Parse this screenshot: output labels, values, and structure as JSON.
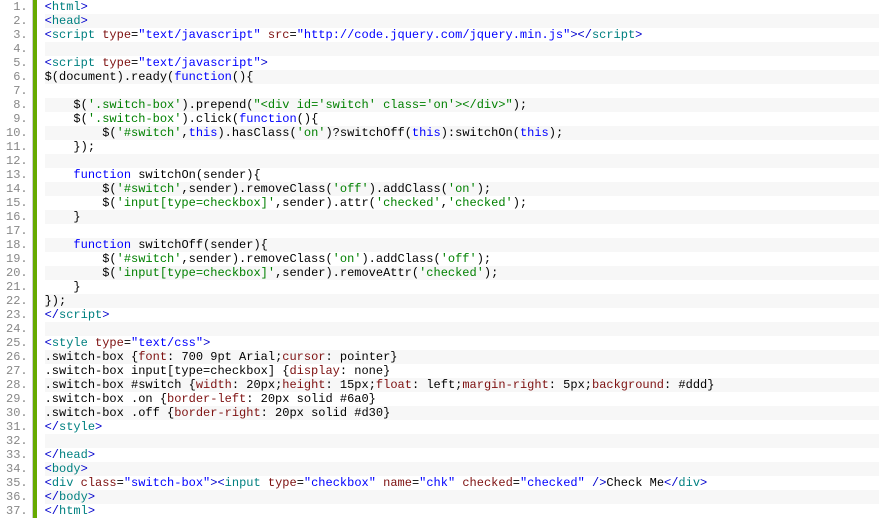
{
  "code": {
    "lines": [
      {
        "n": 1,
        "html": "<span class='t-blue'>&lt;</span><span class='t-tag'>html</span><span class='t-blue'>&gt;</span>"
      },
      {
        "n": 2,
        "html": "<span class='t-blue'>&lt;</span><span class='t-tag'>head</span><span class='t-blue'>&gt;</span>"
      },
      {
        "n": 3,
        "html": "<span class='t-blue'>&lt;</span><span class='t-tag'>script</span> <span class='t-attr'>type</span>=<span class='t-val'>\"text/javascript\"</span> <span class='t-attr'>src</span>=<span class='t-val'>\"http://code.jquery.com/jquery.min.js\"</span><span class='t-blue'>&gt;&lt;/</span><span class='t-tag'>script</span><span class='t-blue'>&gt;</span>"
      },
      {
        "n": 4,
        "html": ""
      },
      {
        "n": 5,
        "html": "<span class='t-blue'>&lt;</span><span class='t-tag'>script</span> <span class='t-attr'>type</span>=<span class='t-val'>\"text/javascript\"</span><span class='t-blue'>&gt;</span>"
      },
      {
        "n": 6,
        "html": "$(document).ready(<span class='t-key'>function</span>(){"
      },
      {
        "n": 7,
        "html": ""
      },
      {
        "n": 8,
        "html": "    $(<span class='t-str'>'.switch-box'</span>).prepend(<span class='t-str'>\"&lt;div id='switch' class='on'&gt;&lt;/div&gt;\"</span>);"
      },
      {
        "n": 9,
        "html": "    $(<span class='t-str'>'.switch-box'</span>).click(<span class='t-key'>function</span>(){"
      },
      {
        "n": 10,
        "html": "        $(<span class='t-str'>'#switch'</span>,<span class='t-key'>this</span>).hasClass(<span class='t-str'>'on'</span>)?switchOff(<span class='t-key'>this</span>):switchOn(<span class='t-key'>this</span>);"
      },
      {
        "n": 11,
        "html": "    });"
      },
      {
        "n": 12,
        "html": ""
      },
      {
        "n": 13,
        "html": "    <span class='t-key'>function</span> switchOn(sender){"
      },
      {
        "n": 14,
        "html": "        $(<span class='t-str'>'#switch'</span>,sender).removeClass(<span class='t-str'>'off'</span>).addClass(<span class='t-str'>'on'</span>);"
      },
      {
        "n": 15,
        "html": "        $(<span class='t-str'>'input[type=checkbox]'</span>,sender).attr(<span class='t-str'>'checked'</span>,<span class='t-str'>'checked'</span>);"
      },
      {
        "n": 16,
        "html": "    }"
      },
      {
        "n": 17,
        "html": ""
      },
      {
        "n": 18,
        "html": "    <span class='t-key'>function</span> switchOff(sender){"
      },
      {
        "n": 19,
        "html": "        $(<span class='t-str'>'#switch'</span>,sender).removeClass(<span class='t-str'>'on'</span>).addClass(<span class='t-str'>'off'</span>);"
      },
      {
        "n": 20,
        "html": "        $(<span class='t-str'>'input[type=checkbox]'</span>,sender).removeAttr(<span class='t-str'>'checked'</span>);"
      },
      {
        "n": 21,
        "html": "    }"
      },
      {
        "n": 22,
        "html": "});"
      },
      {
        "n": 23,
        "html": "<span class='t-blue'>&lt;/</span><span class='t-tag'>script</span><span class='t-blue'>&gt;</span>"
      },
      {
        "n": 24,
        "html": ""
      },
      {
        "n": 25,
        "html": "<span class='t-blue'>&lt;</span><span class='t-tag'>style</span> <span class='t-attr'>type</span>=<span class='t-val'>\"text/css\"</span><span class='t-blue'>&gt;</span>"
      },
      {
        "n": 26,
        "html": ".switch-box {<span class='t-attr'>font</span>: 700 9pt Arial;<span class='t-attr'>cursor</span>: pointer}"
      },
      {
        "n": 27,
        "html": ".switch-box input[type=checkbox] {<span class='t-attr'>display</span>: none}"
      },
      {
        "n": 28,
        "html": ".switch-box #switch {<span class='t-attr'>width</span>: 20px;<span class='t-attr'>height</span>: 15px;<span class='t-attr'>float</span>: left;<span class='t-attr'>margin-right</span>: 5px;<span class='t-attr'>background</span>: #ddd}"
      },
      {
        "n": 29,
        "html": ".switch-box .on {<span class='t-attr'>border-left</span>: 20px solid #6a0}"
      },
      {
        "n": 30,
        "html": ".switch-box .off {<span class='t-attr'>border-right</span>: 20px solid #d30}"
      },
      {
        "n": 31,
        "html": "<span class='t-blue'>&lt;/</span><span class='t-tag'>style</span><span class='t-blue'>&gt;</span>"
      },
      {
        "n": 32,
        "html": ""
      },
      {
        "n": 33,
        "html": "<span class='t-blue'>&lt;/</span><span class='t-tag'>head</span><span class='t-blue'>&gt;</span>"
      },
      {
        "n": 34,
        "html": "<span class='t-blue'>&lt;</span><span class='t-tag'>body</span><span class='t-blue'>&gt;</span>"
      },
      {
        "n": 35,
        "html": "<span class='t-blue'>&lt;</span><span class='t-tag'>div</span> <span class='t-attr'>class</span>=<span class='t-val'>\"switch-box\"</span><span class='t-blue'>&gt;&lt;</span><span class='t-tag'>input</span> <span class='t-attr'>type</span>=<span class='t-val'>\"checkbox\"</span> <span class='t-attr'>name</span>=<span class='t-val'>\"chk\"</span> <span class='t-attr'>checked</span>=<span class='t-val'>\"checked\"</span> <span class='t-blue'>/&gt;</span>Check Me<span class='t-blue'>&lt;/</span><span class='t-tag'>div</span><span class='t-blue'>&gt;</span>"
      },
      {
        "n": 36,
        "html": "<span class='t-blue'>&lt;/</span><span class='t-tag'>body</span><span class='t-blue'>&gt;</span>"
      },
      {
        "n": 37,
        "html": "<span class='t-blue'>&lt;/</span><span class='t-tag'>html</span><span class='t-blue'>&gt;</span>"
      }
    ]
  }
}
